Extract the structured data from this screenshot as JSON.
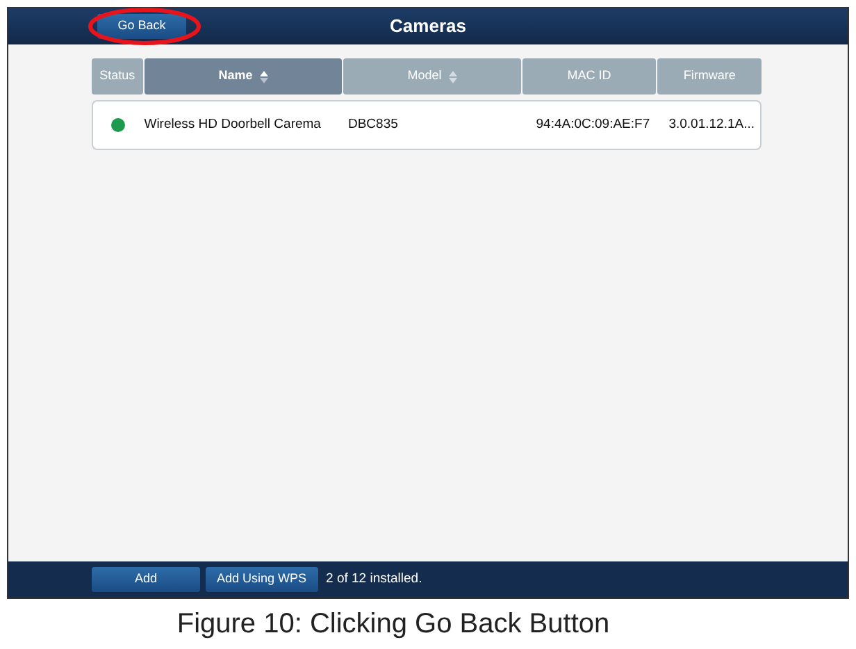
{
  "header": {
    "back_button": "Go Back",
    "title": "Cameras",
    "back_button_highlighted": true
  },
  "table": {
    "columns": [
      {
        "label": "Status",
        "sortable": false,
        "selected": false
      },
      {
        "label": "Name",
        "sortable": true,
        "selected": true
      },
      {
        "label": "Model",
        "sortable": true,
        "selected": false
      },
      {
        "label": "MAC ID",
        "sortable": false,
        "selected": false
      },
      {
        "label": "Firmware",
        "sortable": false,
        "selected": false
      }
    ],
    "rows": [
      {
        "color": "#1e9a4e",
        "name": "Wireless HD Doorbell Carema",
        "model": "DBC835",
        "mac_id": "94:4A:0C:09:AE:F7",
        "firmware": "3.0.01.12.1A..."
      }
    ]
  },
  "footer": {
    "buttons": [
      "Add",
      "Add Using WPS"
    ],
    "status": "2 of 12 installed."
  },
  "caption": "Figure 10: Clicking Go Back Button"
}
